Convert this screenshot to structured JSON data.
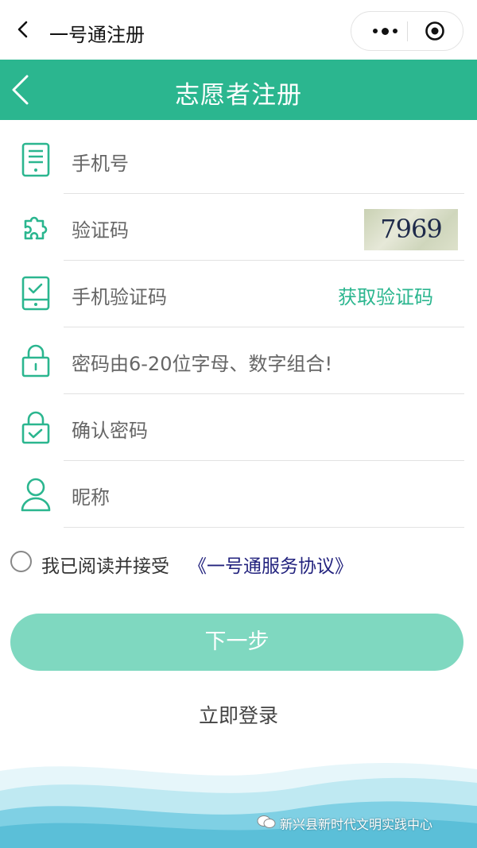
{
  "topbar": {
    "title": "一号通注册"
  },
  "header": {
    "title": "志愿者注册"
  },
  "form": {
    "phone_placeholder": "手机号",
    "captcha_placeholder": "验证码",
    "captcha_code": "7969",
    "sms_code_placeholder": "手机验证码",
    "get_code_label": "获取验证码",
    "password_placeholder": "密码由6-20位字母、数字组合!",
    "confirm_password_placeholder": "确认密码",
    "nickname_placeholder": "昵称"
  },
  "agreement": {
    "checked": false,
    "text": "我已阅读并接受",
    "link": "《一号通服务协议》"
  },
  "actions": {
    "next_label": "下一步",
    "login_label": "立即登录"
  },
  "watermark": "新兴县新时代文明实践中心",
  "colors": {
    "primary": "#2bb68f",
    "button": "#7fd8c0",
    "link": "#23237e"
  }
}
